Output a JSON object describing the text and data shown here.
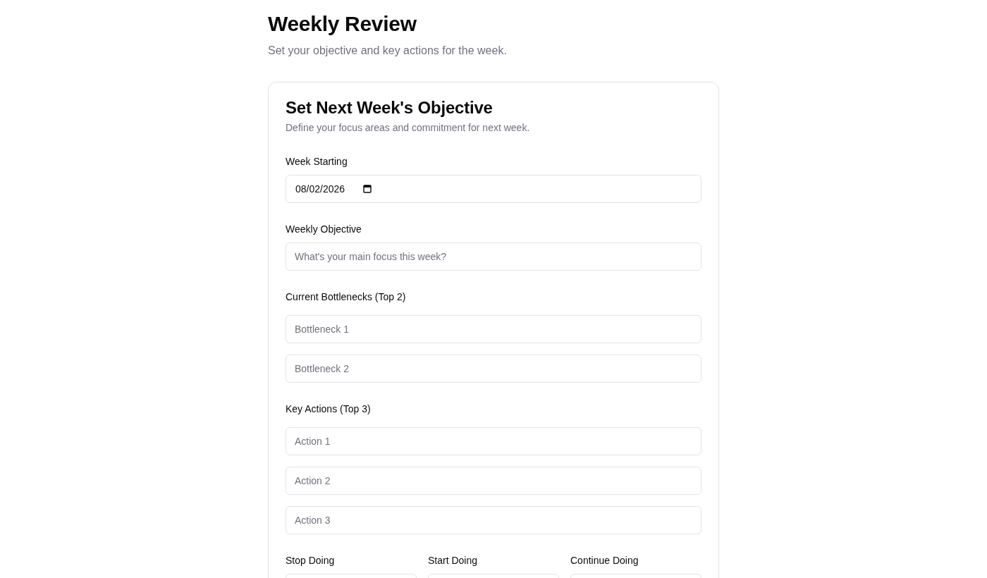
{
  "header": {
    "title": "Weekly Review",
    "subtitle": "Set your objective and key actions for the week."
  },
  "card": {
    "title": "Set Next Week's Objective",
    "description": "Define your focus areas and commitment for next week.",
    "fields": [
      {
        "kind": "date",
        "label": "Week Starting",
        "inputs": [
          {
            "value": "08/02/2026"
          }
        ]
      },
      {
        "kind": "text",
        "label": "Weekly Objective",
        "inputs": [
          {
            "placeholder": "What's your main focus this week?"
          }
        ]
      },
      {
        "kind": "list",
        "label": "Current Bottlenecks (Top 2)",
        "inputs": [
          {
            "placeholder": "Bottleneck 1"
          },
          {
            "placeholder": "Bottleneck 2"
          }
        ]
      },
      {
        "kind": "list",
        "label": "Key Actions (Top 3)",
        "inputs": [
          {
            "placeholder": "Action 1"
          },
          {
            "placeholder": "Action 2"
          },
          {
            "placeholder": "Action 3"
          }
        ]
      }
    ],
    "habits": [
      {
        "label": "Stop Doing"
      },
      {
        "label": "Start Doing"
      },
      {
        "label": "Continue Doing"
      }
    ]
  }
}
